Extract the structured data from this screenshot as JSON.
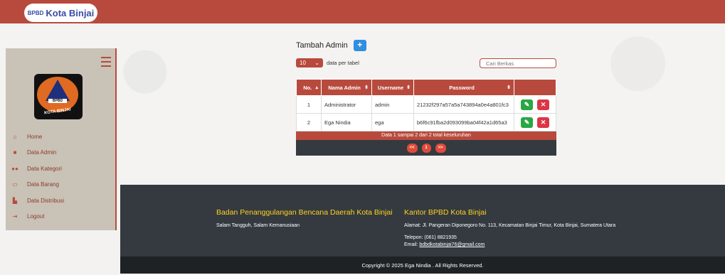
{
  "brand": {
    "prefix": "BPBD",
    "name": "Kota Binjai"
  },
  "sidebar": {
    "logo": {
      "top_text": "BADAN PENANGGULANGAN BENCANA DAERAH",
      "center_text": "BPBD",
      "bottom_text": "KOTA BINJAI"
    },
    "items": [
      {
        "label": "Home",
        "icon": "home-icon",
        "glyph": "⌂"
      },
      {
        "label": "Data Admin",
        "icon": "user-icon",
        "glyph": "👤"
      },
      {
        "label": "Data Kategori",
        "icon": "users-icon",
        "glyph": "👥"
      },
      {
        "label": "Data Barang",
        "icon": "monitor-icon",
        "glyph": "▭"
      },
      {
        "label": "Data Distribusi",
        "icon": "truck-icon",
        "glyph": "▙"
      },
      {
        "label": "Logout",
        "icon": "logout-icon",
        "glyph": "⇥"
      }
    ]
  },
  "main": {
    "title": "Tambah Admin",
    "add_label": "+",
    "per_page_value": "10",
    "per_page_label": "data per tabel",
    "search_placeholder": "Cari Berkas",
    "table": {
      "headers": [
        "No.",
        "Nama Admin",
        "Username",
        "Password"
      ],
      "rows": [
        {
          "no": "1",
          "name": "Administrator",
          "username": "admin",
          "password": "21232f297a57a5a743894a0e4a801fc3"
        },
        {
          "no": "2",
          "name": "Ega Nindia",
          "username": "ega",
          "password": "b6f6c91fba2d093099ba04f42a1d65a3"
        }
      ],
      "summary": "Data 1 sampai 2 dari 2 total keseluruhan"
    },
    "pager": {
      "prev": "<<",
      "current": "1",
      "next": ">>"
    }
  },
  "footer": {
    "org_title": "Badan Penanggulangan Bencana Daerah Kota Binjai",
    "org_tagline": "Salam Tangguh, Salam Kemanusiaan",
    "office_title": "Kantor BPBD Kota Binjai",
    "address": "Alamat: Jl. Pangeran Diponegoro No. 113, Kecamatan Binjai Timur, Kota Binjai, Sumatera Utara",
    "phone": "Telepon: (061) 8821935",
    "email_label": "Email:",
    "email": "bdbdkotabinjai76@gmail.com",
    "copyright": "Copyright © 2025 Ega Nindia . All Rights Reserved."
  },
  "colors": {
    "primary": "#b84a3d",
    "dark": "#343a40",
    "accent": "#ffd21f",
    "add": "#2f8fe0",
    "edit": "#28a745",
    "delete": "#dc3545"
  }
}
